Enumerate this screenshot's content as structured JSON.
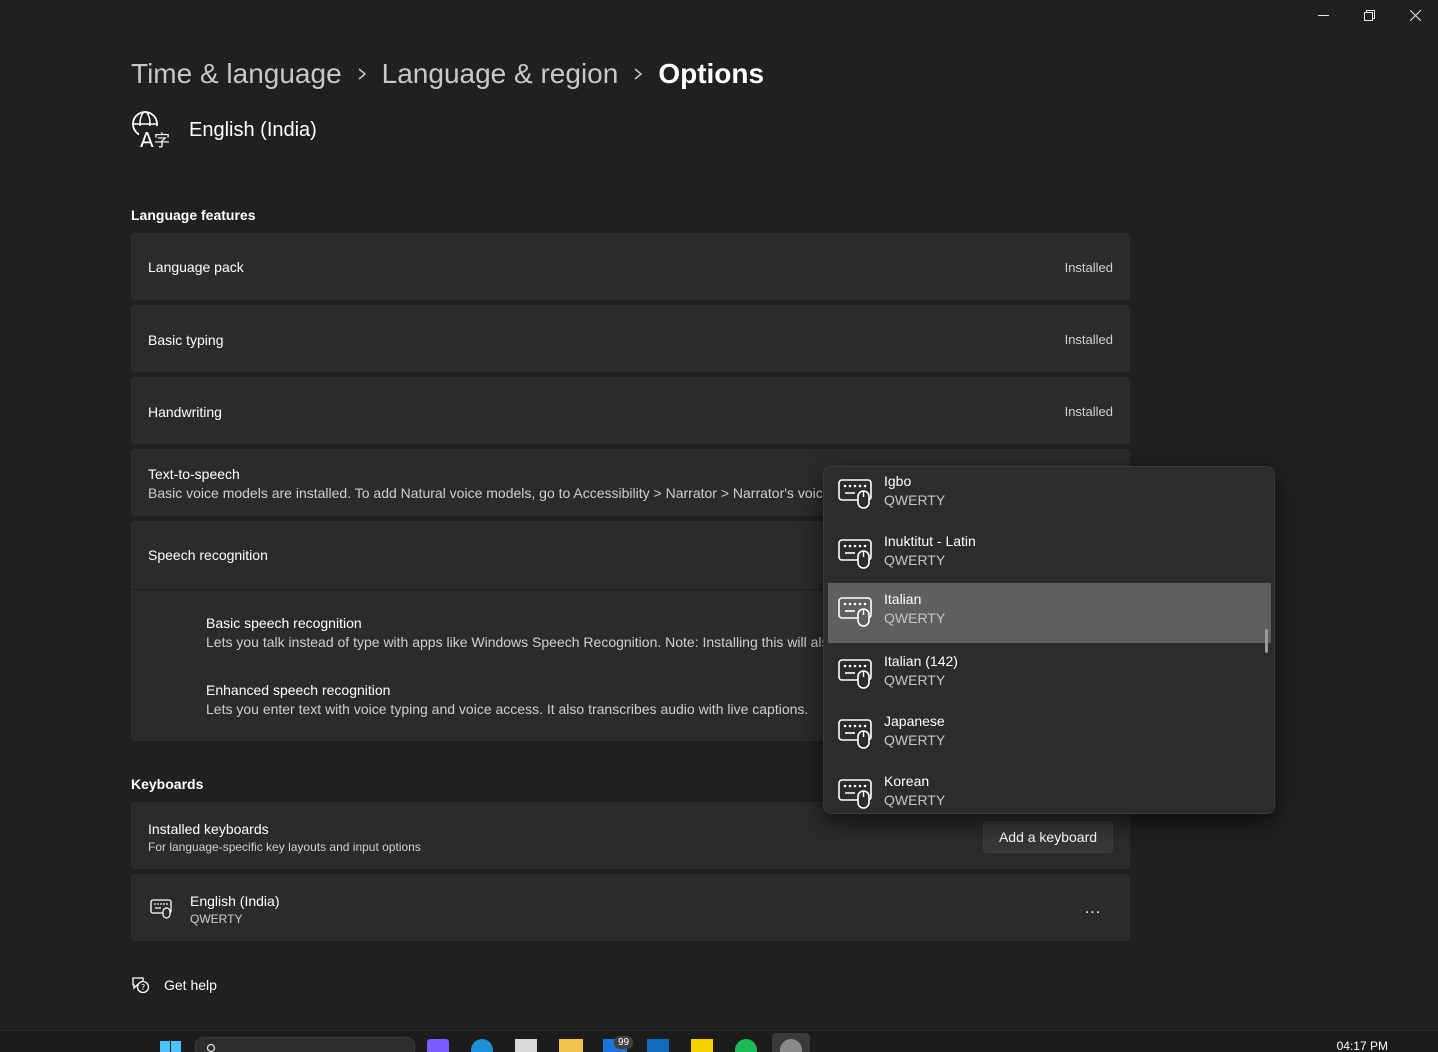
{
  "window": {
    "minimize_label": "Minimize",
    "restore_label": "Restore",
    "close_label": "Close"
  },
  "breadcrumb": {
    "items": [
      "Time & language",
      "Language & region",
      "Options"
    ]
  },
  "language": {
    "name": "English (India)"
  },
  "language_features": {
    "title": "Language features",
    "items": [
      {
        "label": "Language pack",
        "status": "Installed"
      },
      {
        "label": "Basic typing",
        "status": "Installed"
      },
      {
        "label": "Handwriting",
        "status": "Installed"
      }
    ],
    "tts": {
      "label": "Text-to-speech",
      "description": "Basic voice models are installed. To add Natural voice models, go to Accessibility > Narrator > Narrator's voice"
    },
    "speech": {
      "label": "Speech recognition",
      "basic": {
        "label": "Basic speech recognition",
        "description": "Lets you talk instead of type with apps like Windows Speech Recognition. Note: Installing this will also"
      },
      "enhanced": {
        "label": "Enhanced speech recognition",
        "description": "Lets you enter text with voice typing and voice access. It also transcribes audio with live captions."
      }
    }
  },
  "keyboards": {
    "title": "Keyboards",
    "installed_label": "Installed keyboards",
    "installed_desc": "For language-specific key layouts and input options",
    "add_button": "Add a keyboard",
    "list": [
      {
        "name": "English (India)",
        "layout": "QWERTY"
      }
    ],
    "more_label": "..."
  },
  "help": {
    "label": "Get help"
  },
  "dropdown": {
    "items": [
      {
        "name": "Igbo",
        "layout": "QWERTY"
      },
      {
        "name": "Inuktitut - Latin",
        "layout": "QWERTY"
      },
      {
        "name": "Italian",
        "layout": "QWERTY",
        "selected": true
      },
      {
        "name": "Italian (142)",
        "layout": "QWERTY"
      },
      {
        "name": "Japanese",
        "layout": "QWERTY"
      },
      {
        "name": "Korean",
        "layout": "QWERTY"
      }
    ]
  },
  "taskbar": {
    "time": "04:17 PM",
    "mail_badge": "99"
  }
}
